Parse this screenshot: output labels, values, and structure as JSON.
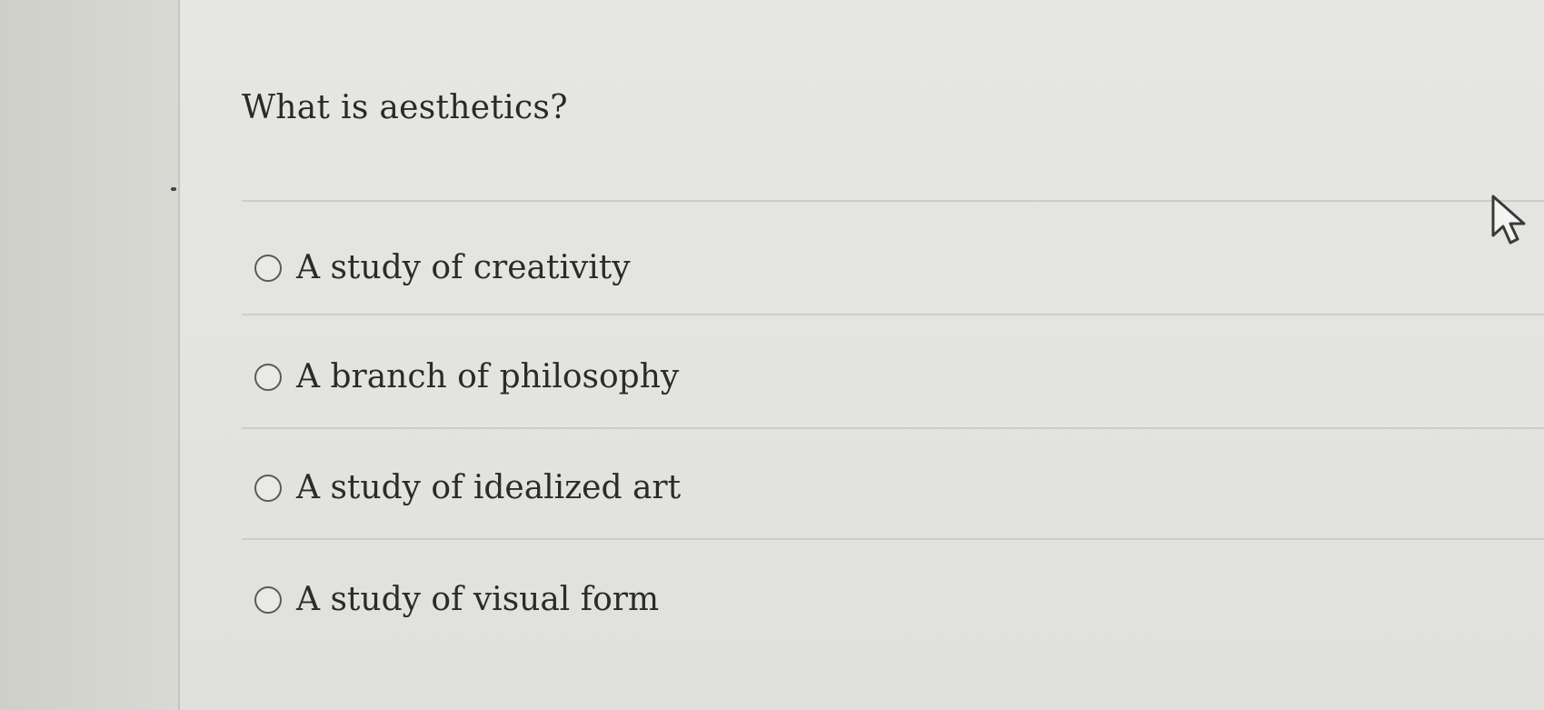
{
  "quiz": {
    "question": "What is aesthetics?",
    "options": [
      {
        "label": "A study of creativity",
        "selected": false
      },
      {
        "label": "A branch of philosophy",
        "selected": false
      },
      {
        "label": "A study of idealized art",
        "selected": false
      },
      {
        "label": "A study of visual form",
        "selected": false
      }
    ]
  },
  "icons": {
    "cursor": "mouse-pointer-icon",
    "radio": "radio-unchecked-icon"
  },
  "colors": {
    "text": "#2b2b2b",
    "background": "#e6e6e3",
    "divider": "#cdcdc9"
  }
}
